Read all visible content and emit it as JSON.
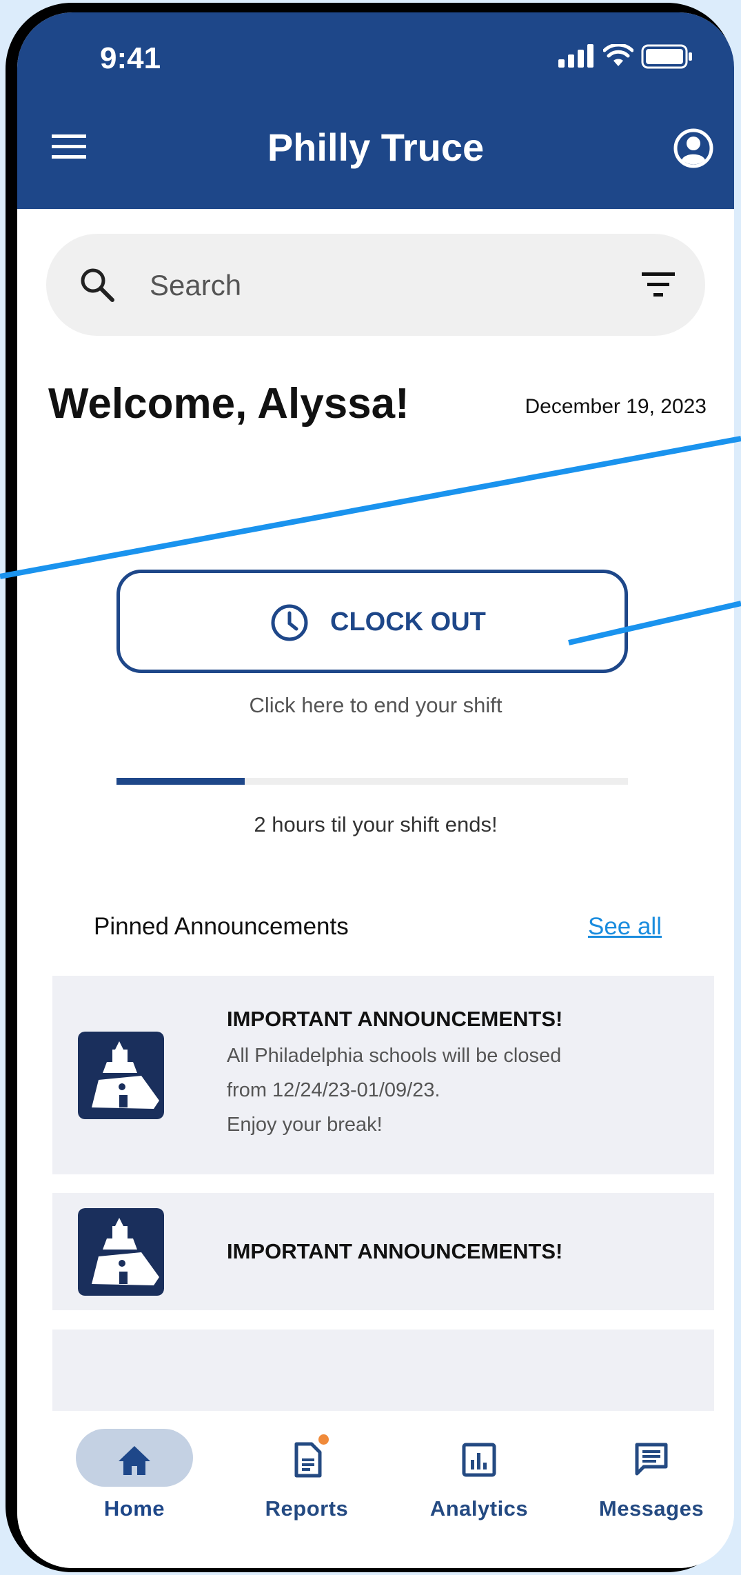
{
  "status_bar": {
    "time": "9:41"
  },
  "header": {
    "title": "Philly Truce"
  },
  "search": {
    "placeholder": "Search"
  },
  "greeting": {
    "welcome": "Welcome, Alyssa!",
    "date": "December 19, 2023"
  },
  "shift": {
    "clock_button_label": "CLOCK OUT",
    "hint": "Click here to end your shift",
    "progress_fraction": 0.25,
    "progress_text": "2 hours til your shift ends!"
  },
  "announcements": {
    "title": "Pinned Announcements",
    "see_all": "See all",
    "items": [
      {
        "title": "IMPORTANT ANNOUNCEMENTS!",
        "lines": [
          "All Philadelphia schools will be closed",
          "from 12/24/23-01/09/23.",
          "Enjoy your break!"
        ]
      },
      {
        "title": "IMPORTANT ANNOUNCEMENTS!"
      }
    ]
  },
  "nav": {
    "items": [
      {
        "label": "Home",
        "icon": "home-icon",
        "active": true
      },
      {
        "label": "Reports",
        "icon": "report-icon",
        "badge": true
      },
      {
        "label": "Analytics",
        "icon": "analytics-icon"
      },
      {
        "label": "Messages",
        "icon": "messages-icon"
      }
    ]
  },
  "colors": {
    "brand_blue": "#1e4789",
    "link_blue": "#1a8cde",
    "badge_orange": "#f08a3a",
    "annotation_line": "#1a93ee"
  }
}
